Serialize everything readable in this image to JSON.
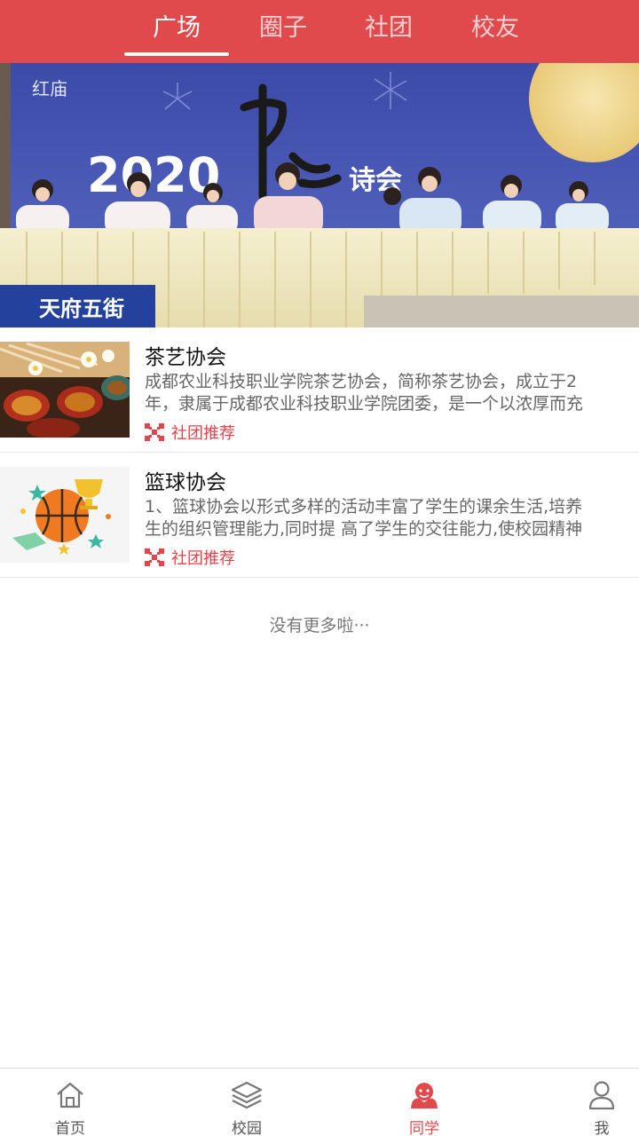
{
  "top_tabs": [
    {
      "label": "广场",
      "active": true
    },
    {
      "label": "圈子",
      "active": false
    },
    {
      "label": "社团",
      "active": false
    },
    {
      "label": "校友",
      "active": false
    }
  ],
  "banner": {
    "year": "2020",
    "title_suffix": "诗会",
    "location": "天府五街",
    "logo": "红庙"
  },
  "items": [
    {
      "title": "茶艺协会",
      "desc_line1": "成都农业科技职业学院茶艺协会，简称茶艺协会，成立于2",
      "desc_line2": "年，隶属于成都农业科技职业学院团委，是一个以浓厚而充",
      "tag": "社团推荐"
    },
    {
      "title": "篮球协会",
      "desc_line1": "1、篮球协会以形式多样的活动丰富了学生的课余生活,培养",
      "desc_line2": "生的组织管理能力,同时提 高了学生的交往能力,使校园精神",
      "tag": "社团推荐"
    }
  ],
  "no_more": "没有更多啦···",
  "bottom_nav": [
    {
      "label": "首页",
      "icon": "home-icon",
      "active": false
    },
    {
      "label": "校园",
      "icon": "layers-icon",
      "active": false
    },
    {
      "label": "同学",
      "icon": "classmates-icon",
      "active": true
    },
    {
      "label": "我",
      "icon": "user-icon",
      "active": false
    }
  ],
  "colors": {
    "brand": "#e04a4d",
    "tag": "#e8424a",
    "text_secondary": "#666666"
  }
}
